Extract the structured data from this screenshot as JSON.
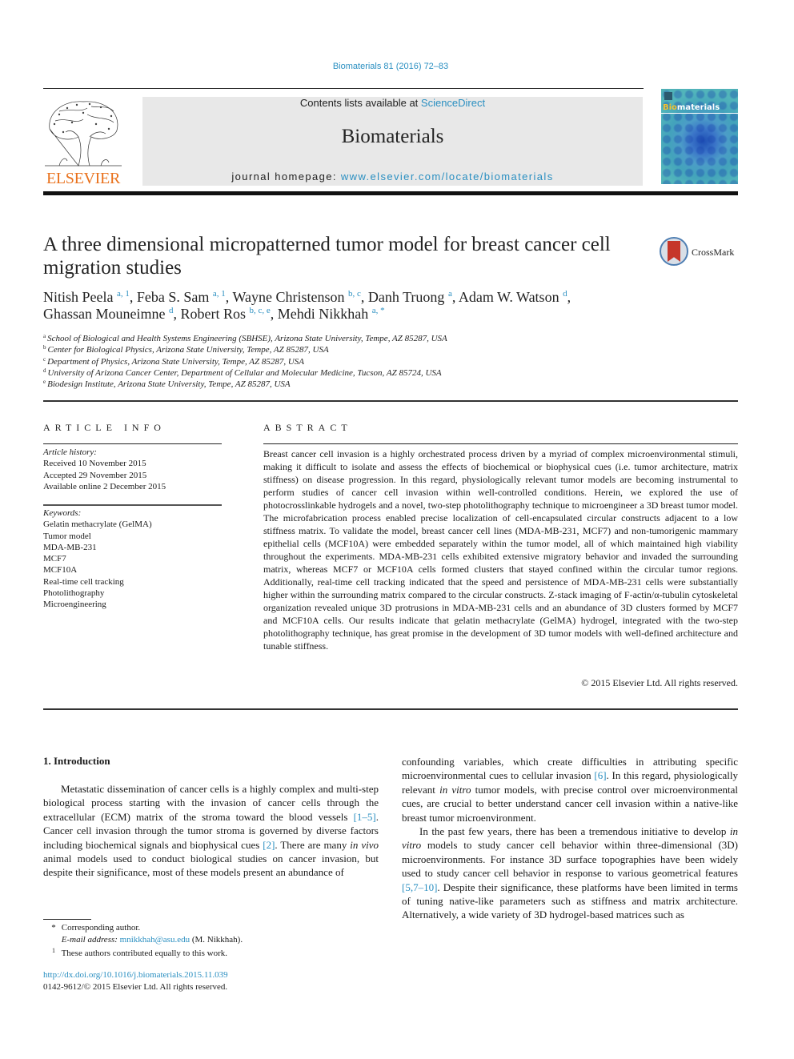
{
  "header": {
    "citation": "Biomaterials 81 (2016) 72–83",
    "contents_prefix": "Contents lists available at ",
    "contents_link": "ScienceDirect",
    "journal_name": "Biomaterials",
    "homepage_prefix": "journal homepage: ",
    "homepage_link": "www.elsevier.com/locate/biomaterials",
    "publisher_logo_text": "ELSEVIER",
    "cover_title_highlight": "Bio",
    "cover_title_rest": "materials",
    "colors": {
      "link": "#2a8fc1",
      "elsevier_orange": "#e9711c",
      "banner_bg": "#e8e8e8"
    }
  },
  "article": {
    "title": "A three dimensional micropatterned tumor model for breast cancer cell migration studies",
    "crossmark_label": "CrossMark",
    "authors": [
      {
        "name": "Nitish Peela",
        "sup": "a, 1",
        "sep": ", "
      },
      {
        "name": "Feba S. Sam",
        "sup": "a, 1",
        "sep": ", "
      },
      {
        "name": "Wayne Christenson",
        "sup": "b, c",
        "sep": ", "
      },
      {
        "name": "Danh Truong",
        "sup": "a",
        "sep": ", "
      },
      {
        "name": "Adam W. Watson",
        "sup": "d",
        "sep": ","
      },
      {
        "name": "Ghassan Mouneimne",
        "sup": "d",
        "sep": ", "
      },
      {
        "name": "Robert Ros",
        "sup": "b, c, e",
        "sep": ", "
      },
      {
        "name": "Mehdi Nikkhah",
        "sup": "a, *",
        "sep": ""
      }
    ],
    "affiliations": [
      {
        "key": "a",
        "text": "School of Biological and Health Systems Engineering (SBHSE), Arizona State University, Tempe, AZ 85287, USA"
      },
      {
        "key": "b",
        "text": "Center for Biological Physics, Arizona State University, Tempe, AZ 85287, USA"
      },
      {
        "key": "c",
        "text": "Department of Physics, Arizona State University, Tempe, AZ 85287, USA"
      },
      {
        "key": "d",
        "text": "University of Arizona Cancer Center, Department of Cellular and Molecular Medicine, Tucson, AZ 85724, USA"
      },
      {
        "key": "e",
        "text": "Biodesign Institute, Arizona State University, Tempe, AZ 85287, USA"
      }
    ]
  },
  "article_info": {
    "heading": "ARTICLE INFO",
    "history_label": "Article history:",
    "history": [
      "Received 10 November 2015",
      "Accepted 29 November 2015",
      "Available online 2 December 2015"
    ],
    "keywords_label": "Keywords:",
    "keywords": [
      "Gelatin methacrylate (GelMA)",
      "Tumor model",
      "MDA-MB-231",
      "MCF7",
      "MCF10A",
      "Real-time cell tracking",
      "Photolithography",
      "Microengineering"
    ]
  },
  "abstract": {
    "heading": "ABSTRACT",
    "text_1": "Breast cancer cell invasion is a highly orchestrated process driven by a myriad of complex microenvi­ronmental stimuli, making it difficult to isolate and assess the effects of biochemical or biophysical cues (i.e. tumor architecture, matrix stiffness) on disease progression. In this regard, physiologically relevant tumor models are becoming instrumental to perform studies of cancer cell invasion within well-controlled conditions. Herein, we explored the use of photocrosslinkable hydrogels and a novel, two-step photolithography technique to microengineer a 3D breast tumor model. The microfabrication process enabled precise localization of cell-encapsulated circular constructs adjacent to a low stiffness matrix. To validate the model, breast cancer cell lines (MDA-MB-231, MCF7) and non-tumorigenic mammary epithelial cells (MCF10A) were embedded separately within the tumor model, all of which maintained high viability throughout the experiments. MDA-MB-231 cells exhibited extensive migratory behavior and invaded the surrounding matrix, whereas MCF7 or MCF10A cells formed clusters that stayed confined within the circular tumor regions. Additionally, real-time cell tracking indicated that the speed and persistence of MDA-MB-231 cells were substantially higher within the surrounding matrix compared to the circular constructs. Z-stack imaging of F-actin/α-tubulin cytoskeletal organization revealed unique 3D protrusions in MDA-MB-231 cells and an abundance of 3D clusters formed by MCF7 and MCF10A cells. Our results indicate that gelatin methacrylate (GelMA) hydrogel, integrated with the two-step photolithography technique, has great promise in the development of 3D tumor models with well-defined architecture and tunable stiffness.",
    "copyright": "© 2015 Elsevier Ltd. All rights reserved."
  },
  "introduction": {
    "heading": "1.  Introduction",
    "left_p1_a": "Metastatic dissemination of cancer cells is a highly complex and multi-step biological process starting with the invasion of cancer cells through the extracellular (ECM) matrix of the stroma toward the blood vessels ",
    "left_p1_ref1": "[1–5]",
    "left_p1_b": ". Cancer cell invasion through the tumor stroma is governed by diverse factors including biochemical signals and biophysical cues ",
    "left_p1_ref2": "[2]",
    "left_p1_c": ". There are many ",
    "left_p1_ital": "in vivo",
    "left_p1_d": " animal models used to conduct biological studies on cancer invasion, but despite their significance, most of these models present an abundance of",
    "right_p1_a": "confounding variables, which create difficulties in attributing spe­cific microenvironmental cues to cellular invasion ",
    "right_p1_ref": "[6]",
    "right_p1_b": ". In this re­gard, physiologically relevant ",
    "right_p1_ital": "in vitro",
    "right_p1_c": " tumor models, with precise control over microenvironmental cues, are crucial to better un­derstand cancer cell invasion within a native-like breast tumor microenvironment.",
    "right_p2_a": "In the past few years, there has been a tremendous initiative to develop ",
    "right_p2_ital": "in vitro",
    "right_p2_b": " models to study cancer cell behavior within three-dimensional (3D) microenvironments. For instance 3D surface to­pographies have been widely used to study cancer cell behavior in response to various geometrical features ",
    "right_p2_ref": "[5,7–10]",
    "right_p2_c": ". Despite their significance, these platforms have been limited in terms of tuning native-like parameters such as stiffness and matrix architecture. Alternatively, a wide variety of 3D hydrogel-based matrices such as"
  },
  "footnotes": {
    "corr_mark": "*",
    "corr_text": "Corresponding author.",
    "email_label": "E-mail address: ",
    "email": "mnikkhah@asu.edu",
    "email_suffix": " (M. Nikkhah).",
    "equal_mark": "1",
    "equal_text": "These authors contributed equally to this work.",
    "doi": "http://dx.doi.org/10.1016/j.biomaterials.2015.11.039",
    "issn_copyright": "0142-9612/© 2015 Elsevier Ltd. All rights reserved."
  }
}
